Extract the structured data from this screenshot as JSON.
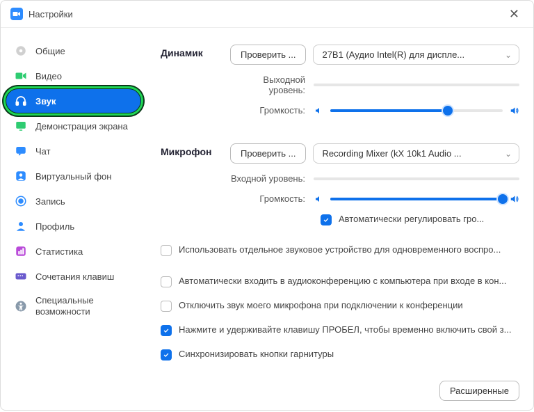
{
  "window": {
    "title": "Настройки"
  },
  "sidebar": {
    "items": [
      {
        "label": "Общие"
      },
      {
        "label": "Видео"
      },
      {
        "label": "Звук"
      },
      {
        "label": "Демонстрация экрана"
      },
      {
        "label": "Чат"
      },
      {
        "label": "Виртуальный фон"
      },
      {
        "label": "Запись"
      },
      {
        "label": "Профиль"
      },
      {
        "label": "Статистика"
      },
      {
        "label": "Сочетания клавиш"
      },
      {
        "label": "Специальные возможности"
      }
    ],
    "selected_index": 2
  },
  "speaker": {
    "title": "Динамик",
    "test_button": "Проверить ...",
    "device": "27B1 (Аудио Intel(R) для диспле...",
    "output_level_label": "Выходной уровень:",
    "volume_label": "Громкость:",
    "volume_percent": 68
  },
  "mic": {
    "title": "Микрофон",
    "test_button": "Проверить ...",
    "device": "Recording Mixer (kX 10k1 Audio ...",
    "input_level_label": "Входной уровень:",
    "volume_label": "Громкость:",
    "volume_percent": 100,
    "auto_gain_label": "Автоматически регулировать гро...",
    "auto_gain_checked": true
  },
  "options": {
    "separate_device": {
      "label": "Использовать отдельное звуковое устройство для одновременного воспро...",
      "checked": false
    },
    "auto_join_audio": {
      "label": "Автоматически входить в аудиоконференцию с компьютера при входе в кон...",
      "checked": false
    },
    "mute_on_join": {
      "label": "Отключить звук моего микрофона при подключении к конференции",
      "checked": false
    },
    "push_to_talk": {
      "label": "Нажмите и удерживайте клавишу ПРОБЕЛ, чтобы временно включить свой з...",
      "checked": true
    },
    "sync_headset": {
      "label": "Синхронизировать кнопки гарнитуры",
      "checked": true
    }
  },
  "footer": {
    "advanced_button": "Расширенные"
  }
}
